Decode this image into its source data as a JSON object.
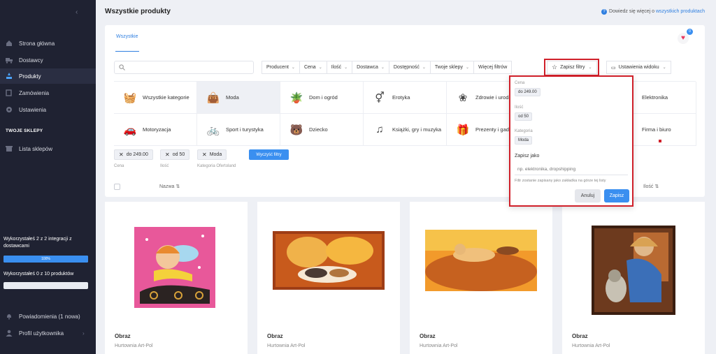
{
  "sidebar": {
    "items": [
      {
        "label": "Strona główna",
        "icon": "home-icon"
      },
      {
        "label": "Dostawcy",
        "icon": "truck-icon"
      },
      {
        "label": "Produkty",
        "icon": "box-icon"
      },
      {
        "label": "Zamówienia",
        "icon": "orders-icon"
      },
      {
        "label": "Ustawienia",
        "icon": "gear-icon"
      }
    ],
    "section_title": "TWOJE SKLEPY",
    "shops_item": "Lista sklepów",
    "usage_integrations": "Wykorzystałeś 2 z 2 integracji z dostawcami",
    "usage_integrations_bar": "100%",
    "usage_integrations_fraction": 1.0,
    "usage_products": "Wykorzystałeś 0 z 10 produktów",
    "usage_products_fraction": 0.0,
    "notifications": "Powiadomienia (1 nowa)",
    "profile": "Profil użytkownika"
  },
  "header": {
    "title": "Wszystkie produkty",
    "learn_prefix": "Dowiedz się więcej o",
    "learn_link": "wszystkich produktach"
  },
  "tabs": {
    "all": "Wszystkie"
  },
  "favorites_count": "0",
  "filters": {
    "buttons": [
      "Producent",
      "Cena",
      "Ilość",
      "Dostawca",
      "Dostępność",
      "Twoje sklepy"
    ],
    "more": "Więcej filtrów",
    "save": "Zapisz filtry",
    "view_settings": "Ustawienia widoku"
  },
  "categories": [
    {
      "label": "Wszystkie kategorie",
      "icon": "basket-icon"
    },
    {
      "label": "Moda",
      "icon": "bag-icon"
    },
    {
      "label": "Dom i ogród",
      "icon": "garden-icon"
    },
    {
      "label": "Erotyka",
      "icon": "gender-icon"
    },
    {
      "label": "Zdrowie i uroda",
      "icon": "lotus-icon"
    },
    {
      "label": "",
      "icon": ""
    },
    {
      "label": "Elektronika",
      "icon": "electronics-icon"
    },
    {
      "label": "Motoryzacja",
      "icon": "car-icon"
    },
    {
      "label": "Sport i turystyka",
      "icon": "bike-icon"
    },
    {
      "label": "Dziecko",
      "icon": "bear-icon"
    },
    {
      "label": "Książki, gry i muzyka",
      "icon": "music-icon"
    },
    {
      "label": "Prezenty i gadżety",
      "icon": "gift-icon"
    },
    {
      "label": "",
      "icon": ""
    },
    {
      "label": "Firma i biuro",
      "icon": "office-icon"
    }
  ],
  "active_filters": [
    {
      "value": "do 249.00",
      "label": "Cena"
    },
    {
      "value": "od 50",
      "label": "Ilość"
    },
    {
      "value": "Moda",
      "label": "Kategoria Ofertoland"
    }
  ],
  "clear_filters": "Wyczyść filtry",
  "columns": {
    "name": "Nazwa",
    "qty": "Ilość"
  },
  "products": [
    {
      "title": "Obraz",
      "supplier": "Hurtownia Art-Pol"
    },
    {
      "title": "Obraz",
      "supplier": "Hurtownia Art-Pol"
    },
    {
      "title": "Obraz",
      "supplier": "Hurtownia Art-Pol"
    },
    {
      "title": "Obraz",
      "supplier": "Hurtownia Art-Pol"
    }
  ],
  "save_dropdown": {
    "price_label": "Cena",
    "price_value": "do 249.00",
    "qty_label": "Ilość",
    "qty_value": "od 50",
    "cat_label": "Kategoria",
    "cat_value": "Moda",
    "save_as_label": "Zapisz jako",
    "placeholder": "np. elektronika, dropshipping",
    "help": "Filtr zostanie zapisany jako zakładka na górze tej listy",
    "cancel": "Anuluj",
    "save": "Zapisz"
  },
  "colors": {
    "accent": "#3a8ff0",
    "sidebar": "#1f2232",
    "highlight": "#d0202a"
  }
}
